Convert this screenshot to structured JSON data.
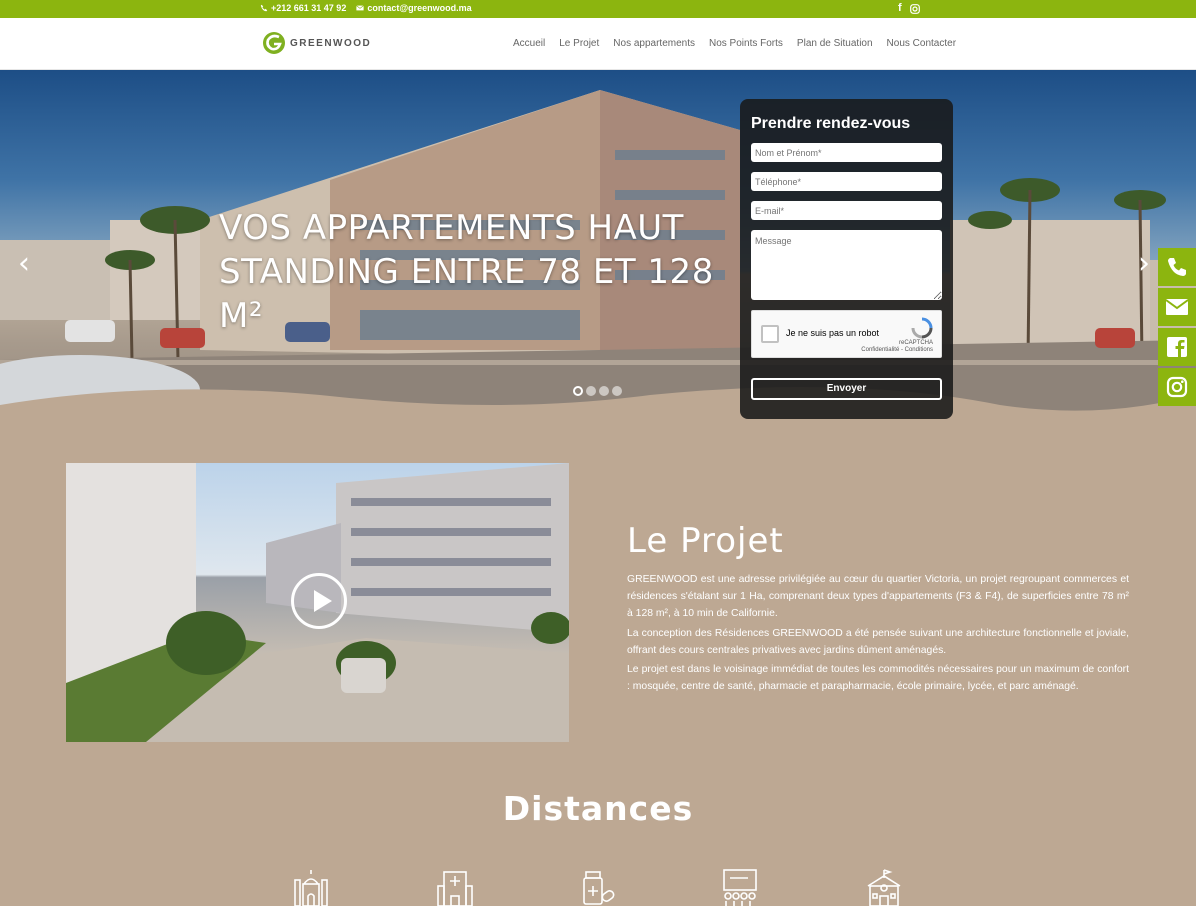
{
  "topbar": {
    "phone": "+212 661 31 47 92",
    "email": "contact@greenwood.ma",
    "social": [
      "facebook-icon",
      "instagram-icon"
    ]
  },
  "header": {
    "logo_text": "GREENWOOD",
    "nav": [
      "Accueil",
      "Le Projet",
      "Nos appartements",
      "Nos Points Forts",
      "Plan de Situation",
      "Nous Contacter"
    ]
  },
  "hero": {
    "title_line1": "VOS APPARTEMENTS HAUT",
    "title_line2": "STANDING ENTRE 78 ET 128 M²",
    "prev_arrow": "‹",
    "next_arrow": "›",
    "slides": 4,
    "active_slide": 1
  },
  "form": {
    "title": "Prendre rendez-vous",
    "name_placeholder": "Nom et Prénom*",
    "phone_placeholder": "Téléphone*",
    "email_placeholder": "E-mail*",
    "message_placeholder": "Message",
    "captcha_label": "Je ne suis pas un robot",
    "captcha_brand": "reCAPTCHA",
    "captcha_links": "Confidentialité - Conditions",
    "submit_label": "Envoyer"
  },
  "side_social": [
    "phone-icon",
    "envelope-icon",
    "facebook-icon",
    "instagram-icon"
  ],
  "projet": {
    "title": "Le Projet",
    "p1": "GREENWOOD est une adresse privilégiée au cœur du quartier Victoria, un projet regroupant commerces et résidences s'étalant sur 1 Ha, comprenant deux types d'appartements (F3 & F4), de superficies entre 78 m² à 128 m², à 10 min de Californie.",
    "p2": "La conception des Résidences GREENWOOD a été pensée suivant une architecture fonctionnelle et joviale, offrant des cours centrales privatives avec jardins dûment aménagés.",
    "p3": "Le projet est dans le voisinage immédiat de toutes les commodités nécessaires pour un maximum de confort : mosquée, centre de santé, pharmacie et parapharmacie, école primaire, lycée, et parc aménagé."
  },
  "distances": {
    "title": "Distances",
    "icons": [
      "mosque-icon",
      "hospital-icon",
      "pharmacy-icon",
      "school-icon",
      "high-school-icon"
    ]
  },
  "colors": {
    "brand_green": "#8cb50f",
    "background": "#bda893",
    "form_bg": "#191919"
  }
}
